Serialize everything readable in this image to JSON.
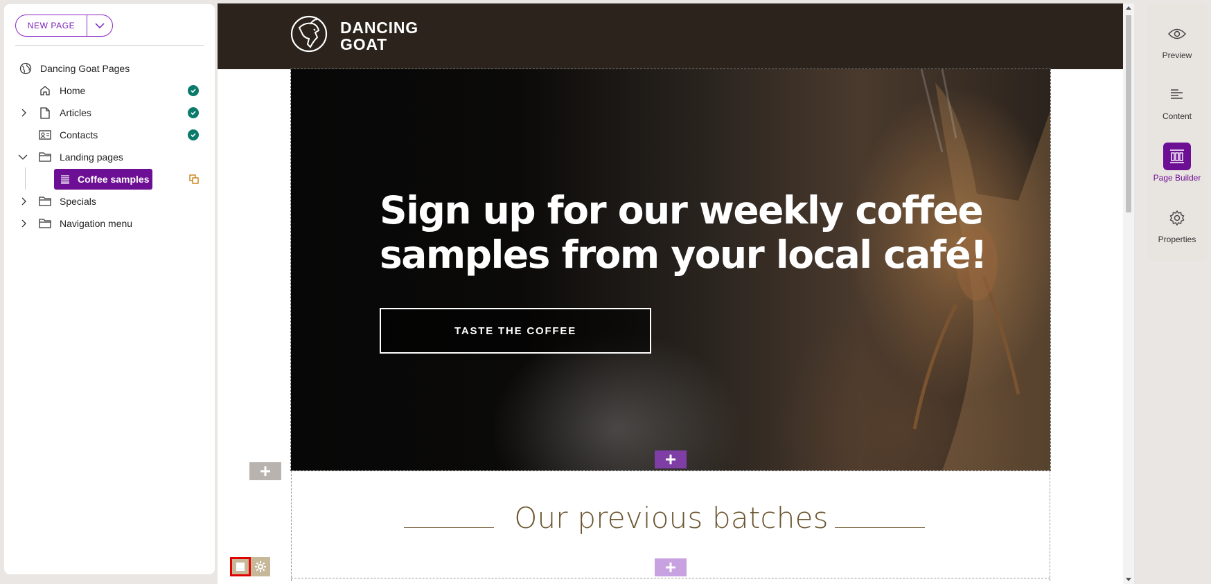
{
  "toolbar": {
    "new_page_label": "NEW PAGE"
  },
  "tree": {
    "root_label": "Dancing Goat Pages",
    "items": [
      {
        "label": "Home",
        "status": "published"
      },
      {
        "label": "Articles",
        "status": "published"
      },
      {
        "label": "Contacts",
        "status": "published"
      },
      {
        "label": "Landing pages",
        "status": ""
      },
      {
        "label": "Coffee samples",
        "status": "changed"
      },
      {
        "label": "Specials",
        "status": ""
      },
      {
        "label": "Navigation menu",
        "status": ""
      }
    ]
  },
  "site": {
    "logo_line1": "DANCING",
    "logo_line2": "GOAT",
    "hero_heading_line1": "Sign up for our weekly coffee",
    "hero_heading_line2": "samples from your local café!",
    "hero_cta": "TASTE THE COFFEE",
    "section_title": "Our previous batches"
  },
  "rail": {
    "items": [
      {
        "label": "Preview",
        "icon": "eye-icon"
      },
      {
        "label": "Content",
        "icon": "content-lines-icon"
      },
      {
        "label": "Page Builder",
        "icon": "page-builder-icon",
        "active": true
      },
      {
        "label": "Properties",
        "icon": "gear-icon"
      }
    ]
  },
  "colors": {
    "accent_purple": "#6d0f94",
    "status_green": "#0a7b6a",
    "header_dark": "#2b231c",
    "title_brown": "#6b5630",
    "selection_red": "#e00000"
  }
}
